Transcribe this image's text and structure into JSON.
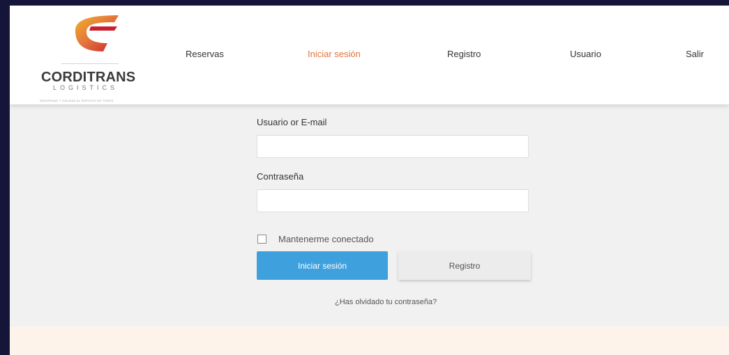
{
  "brand": {
    "name": "CORDITRANS",
    "subtitle": "LOGISTICS",
    "tagline": "SEGURIDAD Y CALIDAD AL SERVICIO DE TODOS",
    "colors": {
      "primary": "#e2733d",
      "accent": "#c8202f",
      "gold": "#f3b12a"
    }
  },
  "nav": {
    "items": [
      {
        "label": "Reservas",
        "active": false
      },
      {
        "label": "Iniciar sesión",
        "active": true
      },
      {
        "label": "Registro",
        "active": false
      },
      {
        "label": "Usuario",
        "active": false
      },
      {
        "label": "Salir",
        "active": false
      }
    ]
  },
  "login": {
    "username_label": "Usuario or E-mail",
    "username_value": "",
    "password_label": "Contraseña",
    "password_value": "",
    "remember_label": "Mantenerme conectado",
    "remember_checked": false,
    "submit_label": "Iniciar sesión",
    "register_label": "Registro",
    "forgot_label": "¿Has olvidado tu contraseña?"
  },
  "colors": {
    "primary_button": "#3ea1de",
    "active_nav": "#e2733d",
    "background": "#f1f1f1",
    "footer": "#fdf3ea"
  }
}
